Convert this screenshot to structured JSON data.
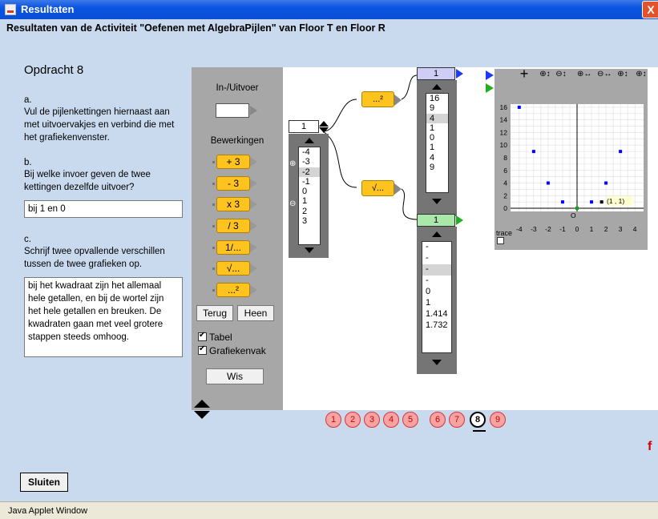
{
  "window": {
    "title": "Resultaten",
    "close": "X"
  },
  "heading": "Resultaten van de Activiteit \"Oefenen met AlgebraPijlen\" van Floor T en Floor R",
  "task": {
    "title": "Opdracht 8",
    "a_label": "a.",
    "a_text": "Vul de pijlenkettingen hiernaast aan met uitvoervakjes en verbind die met het grafiekenvenster.",
    "b_label": "b.",
    "b_text": "Bij welke invoer geven de twee kettingen dezelfde uitvoer?",
    "b_answer": "bij 1 en 0",
    "c_label": "c.",
    "c_text": "Schrijf twee opvallende verschillen tussen de twee grafieken op.",
    "c_answer": "bij het kwadraat zijn het allemaal hele getallen, en bij de wortel zijn het hele getallen en breuken. De kwadraten gaan met veel grotere stappen steeds omhoog."
  },
  "toolpanel": {
    "io_label": "In-/Uitvoer",
    "ops_label": "Bewerkingen",
    "ops": [
      "+ 3",
      "- 3",
      "x 3",
      "/ 3",
      "1/...",
      "√...",
      "...²"
    ],
    "back": "Terug",
    "forward": "Heen",
    "check_table": "Tabel",
    "check_graph": "Grafiekenvak",
    "clear": "Wis"
  },
  "chain": {
    "input_value": "1",
    "input_list": [
      "-4",
      "-3",
      "-2",
      "-1",
      "0",
      "1",
      "2",
      "3"
    ],
    "input_selected": 2,
    "zoom_in": "⊕",
    "zoom_out": "⊖",
    "op_square": "...²",
    "op_sqrt": "√...",
    "square_head": "1",
    "square_list": [
      "16",
      "9",
      "4",
      "1",
      "0",
      "1",
      "4",
      "9"
    ],
    "square_selected": 2,
    "sqrt_head": "1",
    "sqrt_list": [
      "-",
      "-",
      "-",
      "-",
      "0",
      "1",
      "1.414",
      "1.732"
    ],
    "sqrt_selected": 2
  },
  "graph": {
    "tools": [
      "+",
      "⊕↕",
      "⊖↕",
      "⊕↔",
      "⊖↔",
      "⊕↕",
      "⊕↕"
    ],
    "y_ticks": [
      "16",
      "14",
      "12",
      "10",
      "8",
      "6",
      "4",
      "2",
      "0"
    ],
    "x_ticks": [
      "-4",
      "-3",
      "-2",
      "-1",
      "0",
      "1",
      "2",
      "3",
      "4"
    ],
    "origin_label": "O",
    "trace_label": "trace",
    "point_label": "(1 , 1)",
    "colors": {
      "square_series": "#0000ff",
      "sqrt_series": "#00aa00",
      "point": "#000000"
    },
    "square_points": [
      [
        -4,
        16
      ],
      [
        -3,
        9
      ],
      [
        -2,
        4
      ],
      [
        -1,
        1
      ],
      [
        1,
        1
      ],
      [
        2,
        4
      ],
      [
        3,
        9
      ]
    ],
    "sqrt_points": [
      [
        0,
        0
      ]
    ]
  },
  "pages": [
    "1",
    "2",
    "3",
    "4",
    "5",
    "6",
    "7",
    "8",
    "9"
  ],
  "active_page": 7,
  "close_button": "Sluiten",
  "status": "Java Applet Window"
}
